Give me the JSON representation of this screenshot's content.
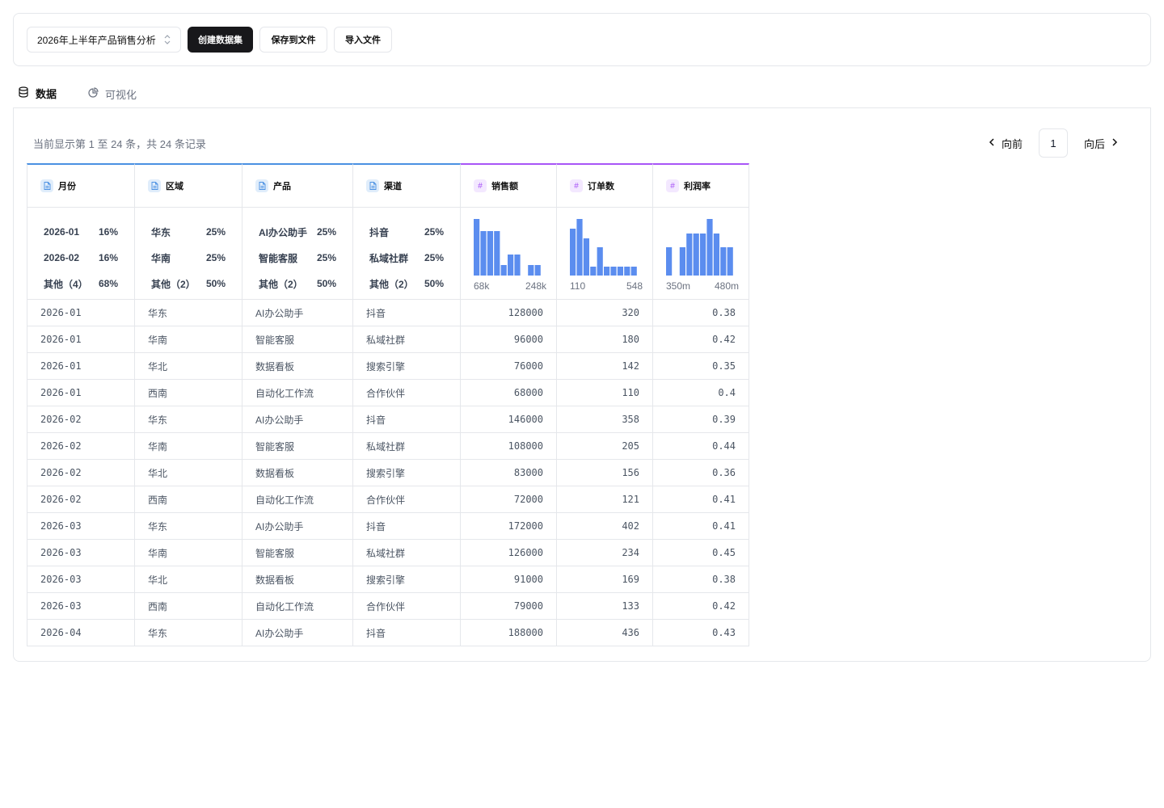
{
  "toolbar": {
    "dataset_select": "2026年上半年产品销售分析",
    "create_label": "创建数据集",
    "save_label": "保存到文件",
    "import_label": "导入文件"
  },
  "tabs": [
    {
      "label": "数据",
      "icon": "database-icon"
    },
    {
      "label": "可视化",
      "icon": "chart-pie-icon"
    }
  ],
  "summary": "当前显示第 1 至 24 条，共 24 条记录",
  "pager": {
    "prev": "向前",
    "page": "1",
    "next": "向后"
  },
  "columns": [
    {
      "name": "月份",
      "type": "text",
      "stats": [
        [
          "2026-01",
          "16%"
        ],
        [
          "2026-02",
          "16%"
        ],
        [
          "其他（4）",
          "68%"
        ]
      ]
    },
    {
      "name": "区域",
      "type": "text",
      "stats": [
        [
          "华东",
          "25%"
        ],
        [
          "华南",
          "25%"
        ],
        [
          "其他（2）",
          "50%"
        ]
      ]
    },
    {
      "name": "产品",
      "type": "text",
      "stats": [
        [
          "AI办公助手",
          "25%"
        ],
        [
          "智能客服",
          "25%"
        ],
        [
          "其他（2）",
          "50%"
        ]
      ]
    },
    {
      "name": "渠道",
      "type": "text",
      "stats": [
        [
          "抖音",
          "25%"
        ],
        [
          "私域社群",
          "25%"
        ],
        [
          "其他（2）",
          "50%"
        ]
      ]
    },
    {
      "name": "销售额",
      "type": "number",
      "hist": [
        7,
        5.5,
        5.5,
        5.5,
        1.3,
        2.6,
        2.6,
        0,
        1.3,
        1.3
      ],
      "min": "68k",
      "max": "248k"
    },
    {
      "name": "订单数",
      "type": "number",
      "hist": [
        5.8,
        7,
        4.6,
        1.1,
        3.5,
        1.1,
        1.1,
        1.1,
        1.1,
        1.1
      ],
      "min": "110",
      "max": "548"
    },
    {
      "name": "利润率",
      "type": "number",
      "hist": [
        3.5,
        0,
        3.5,
        5.2,
        5.2,
        5.2,
        7,
        5.2,
        3.5,
        3.5
      ],
      "min": "350m",
      "max": "480m"
    }
  ],
  "rows": [
    [
      "2026-01",
      "华东",
      "AI办公助手",
      "抖音",
      "128000",
      "320",
      "0.38"
    ],
    [
      "2026-01",
      "华南",
      "智能客服",
      "私域社群",
      "96000",
      "180",
      "0.42"
    ],
    [
      "2026-01",
      "华北",
      "数据看板",
      "搜索引擎",
      "76000",
      "142",
      "0.35"
    ],
    [
      "2026-01",
      "西南",
      "自动化工作流",
      "合作伙伴",
      "68000",
      "110",
      "0.4"
    ],
    [
      "2026-02",
      "华东",
      "AI办公助手",
      "抖音",
      "146000",
      "358",
      "0.39"
    ],
    [
      "2026-02",
      "华南",
      "智能客服",
      "私域社群",
      "108000",
      "205",
      "0.44"
    ],
    [
      "2026-02",
      "华北",
      "数据看板",
      "搜索引擎",
      "83000",
      "156",
      "0.36"
    ],
    [
      "2026-02",
      "西南",
      "自动化工作流",
      "合作伙伴",
      "72000",
      "121",
      "0.41"
    ],
    [
      "2026-03",
      "华东",
      "AI办公助手",
      "抖音",
      "172000",
      "402",
      "0.41"
    ],
    [
      "2026-03",
      "华南",
      "智能客服",
      "私域社群",
      "126000",
      "234",
      "0.45"
    ],
    [
      "2026-03",
      "华北",
      "数据看板",
      "搜索引擎",
      "91000",
      "169",
      "0.38"
    ],
    [
      "2026-03",
      "西南",
      "自动化工作流",
      "合作伙伴",
      "79000",
      "133",
      "0.42"
    ],
    [
      "2026-04",
      "华东",
      "AI办公助手",
      "抖音",
      "188000",
      "436",
      "0.43"
    ]
  ],
  "colors": {
    "text_accent": "#4a90e2",
    "num_accent": "#a855f7",
    "bar": "#5b8def"
  }
}
